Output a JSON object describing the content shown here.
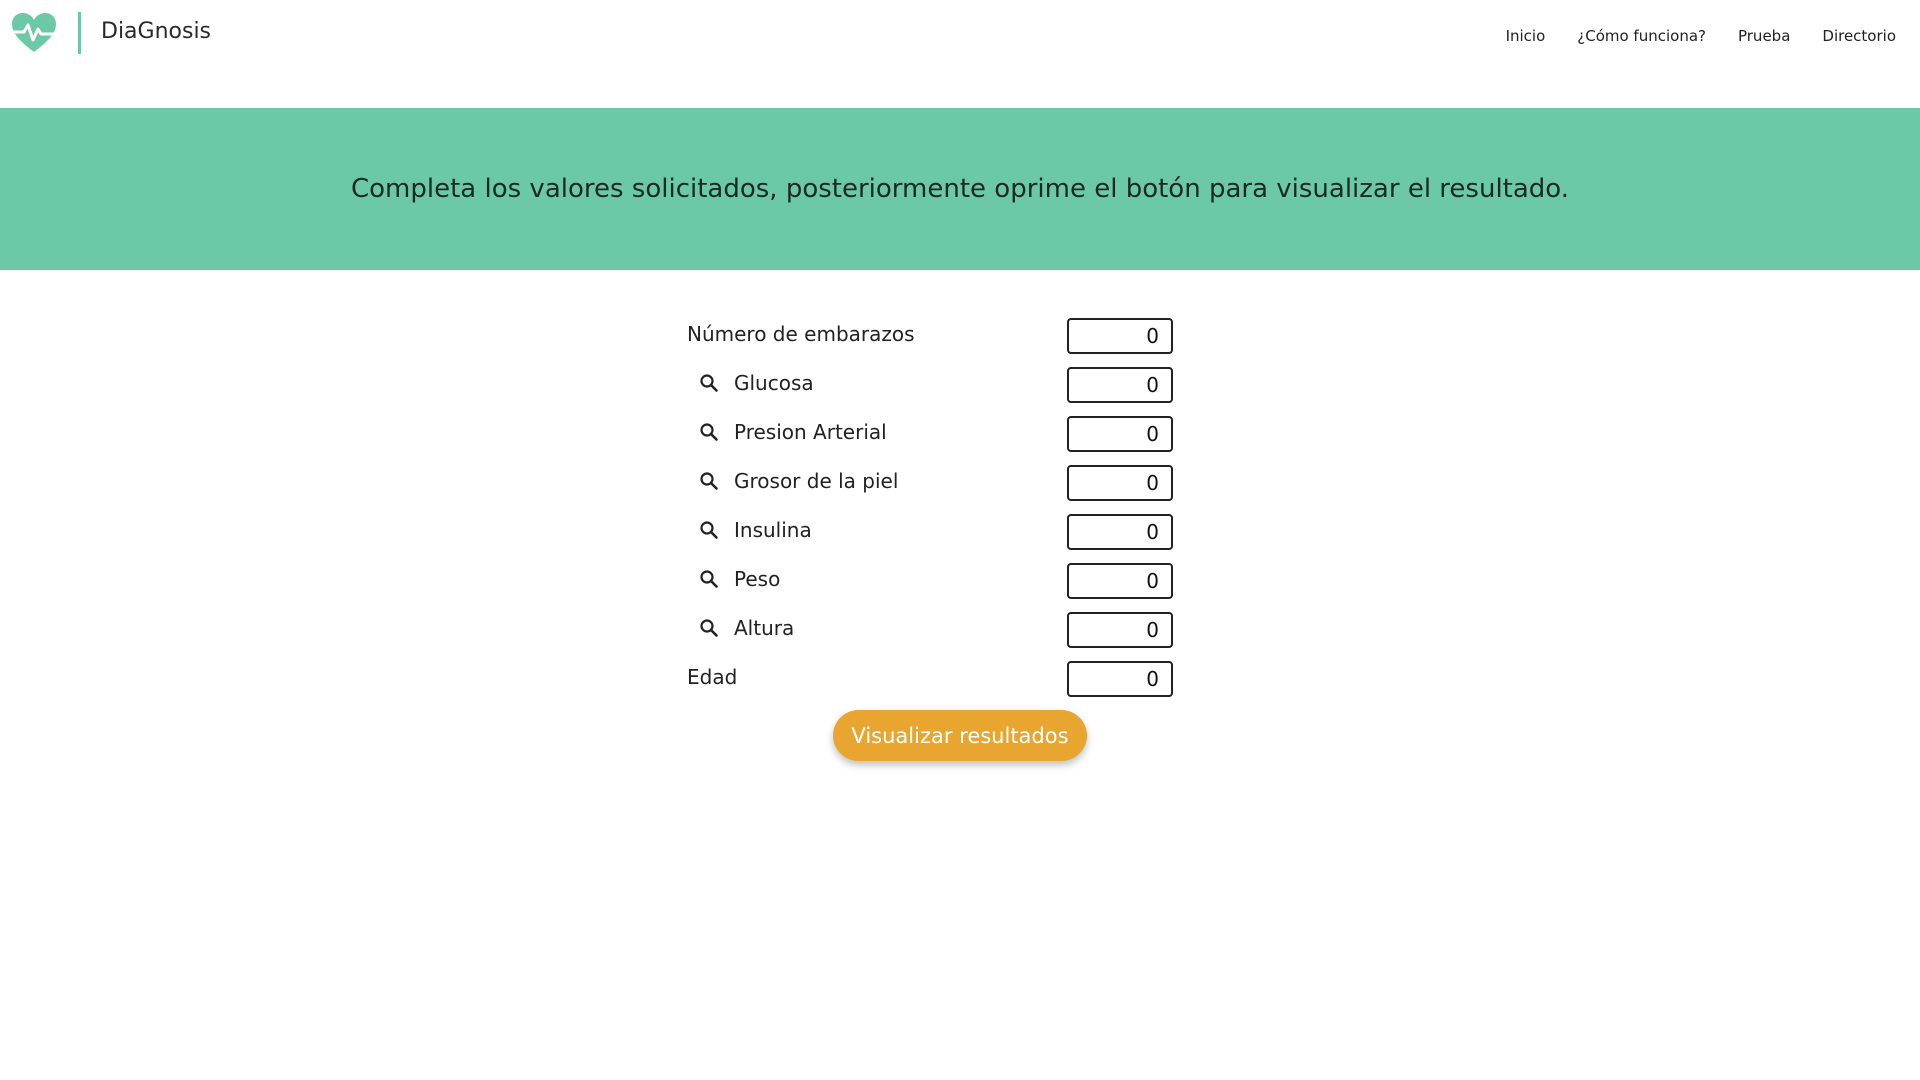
{
  "colors": {
    "accent": "#6cc9a8",
    "button": "#e8a52f"
  },
  "header": {
    "brand": "DiaGnosis",
    "logo_icon": "heart-pulse-icon",
    "nav": [
      "Inicio",
      "¿Cómo funciona?",
      "Prueba",
      "Directorio"
    ]
  },
  "banner": {
    "text": "Completa los valores solicitados, posteriormente oprime el botón para visualizar el resultado."
  },
  "form": {
    "fields": [
      {
        "label": "Número de embarazos",
        "value": "0",
        "icon": ""
      },
      {
        "label": "Glucosa",
        "value": "0",
        "icon": "search-icon"
      },
      {
        "label": "Presion Arterial",
        "value": "0",
        "icon": "search-icon"
      },
      {
        "label": "Grosor de la piel",
        "value": "0",
        "icon": "search-icon"
      },
      {
        "label": "Insulina",
        "value": "0",
        "icon": "search-icon"
      },
      {
        "label": "Peso",
        "value": "0",
        "icon": "search-icon"
      },
      {
        "label": "Altura",
        "value": "0",
        "icon": "search-icon"
      },
      {
        "label": "Edad",
        "value": "0",
        "icon": ""
      }
    ],
    "submit_label": "Visualizar resultados"
  }
}
